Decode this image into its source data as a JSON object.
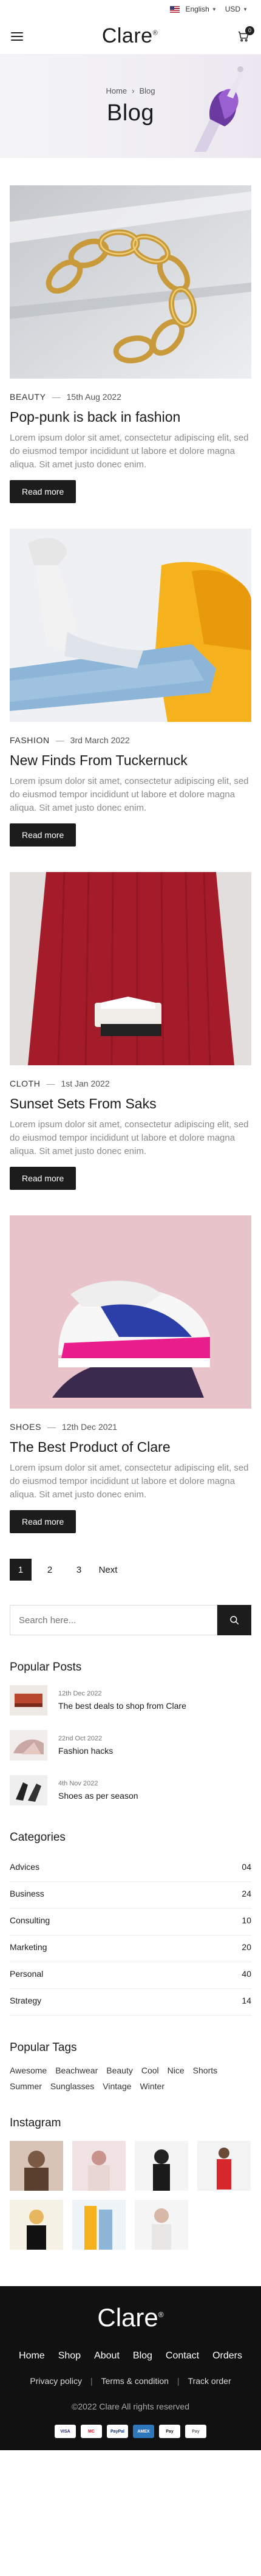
{
  "topbar": {
    "language": "English",
    "currency": "USD"
  },
  "header": {
    "logo": "Clare",
    "logo_mark": "®",
    "cart_count": "0"
  },
  "hero": {
    "crumb_home": "Home",
    "crumb_sep": "›",
    "crumb_current": "Blog",
    "title": "Blog"
  },
  "posts": [
    {
      "category": "BEAUTY",
      "date": "15th Aug 2022",
      "title": "Pop-punk is back in fashion",
      "excerpt": "Lorem ipsum dolor sit amet, consectetur adipiscing elit, sed do eiusmod tempor incididunt ut labore et dolore magna aliqua. Sit amet justo donec enim.",
      "button": "Read more"
    },
    {
      "category": "FASHION",
      "date": "3rd March 2022",
      "title": "New Finds From Tuckernuck",
      "excerpt": "Lorem ipsum dolor sit amet, consectetur adipiscing elit, sed do eiusmod tempor incididunt ut labore et dolore magna aliqua. Sit amet justo donec enim.",
      "button": "Read more"
    },
    {
      "category": "CLOTH",
      "date": "1st Jan 2022",
      "title": "Sunset Sets From Saks",
      "excerpt": "Lorem ipsum dolor sit amet, consectetur adipiscing elit, sed do eiusmod tempor incididunt ut labore et dolore magna aliqua. Sit amet justo donec enim.",
      "button": "Read more"
    },
    {
      "category": "SHOES",
      "date": "12th Dec 2021",
      "title": "The Best Product of Clare",
      "excerpt": "Lorem ipsum dolor sit amet, consectetur adipiscing elit, sed do eiusmod tempor incididunt ut labore et dolore magna aliqua. Sit amet justo donec enim.",
      "button": "Read more"
    }
  ],
  "pagination": {
    "pages": [
      "1",
      "2",
      "3"
    ],
    "next": "Next",
    "active": "1"
  },
  "search": {
    "placeholder": "Search here..."
  },
  "popular_posts": {
    "title": "Popular Posts",
    "items": [
      {
        "date": "12th Dec 2022",
        "title": "The best deals to shop from Clare"
      },
      {
        "date": "22nd Oct 2022",
        "title": "Fashion hacks"
      },
      {
        "date": "4th Nov 2022",
        "title": "Shoes as per season"
      }
    ]
  },
  "categories": {
    "title": "Categories",
    "items": [
      {
        "name": "Advices",
        "count": "04"
      },
      {
        "name": "Business",
        "count": "24"
      },
      {
        "name": "Consulting",
        "count": "10"
      },
      {
        "name": "Marketing",
        "count": "20"
      },
      {
        "name": "Personal",
        "count": "40"
      },
      {
        "name": "Strategy",
        "count": "14"
      }
    ]
  },
  "tags": {
    "title": "Popular Tags",
    "items": [
      "Awesome",
      "Beachwear",
      "Beauty",
      "Cool",
      "Nice",
      "Shorts",
      "Summer",
      "Sunglasses",
      "Vintage",
      "Winter"
    ]
  },
  "instagram": {
    "title": "Instagram"
  },
  "footer": {
    "logo": "Clare",
    "logo_mark": "®",
    "nav": [
      "Home",
      "Shop",
      "About",
      "Blog",
      "Contact",
      "Orders"
    ],
    "links": [
      "Privacy policy",
      "Terms & condition",
      "Track order"
    ],
    "separator": "|",
    "copyright": "©2022 Clare All rights reserved",
    "payments": [
      "VISA",
      "MC",
      "PayPal",
      "AMEX",
      "Pay",
      "Pay"
    ]
  },
  "colors": {
    "accent": "#1c1c1c",
    "muted": "#8a8a8a",
    "footer_bg": "#111111"
  }
}
